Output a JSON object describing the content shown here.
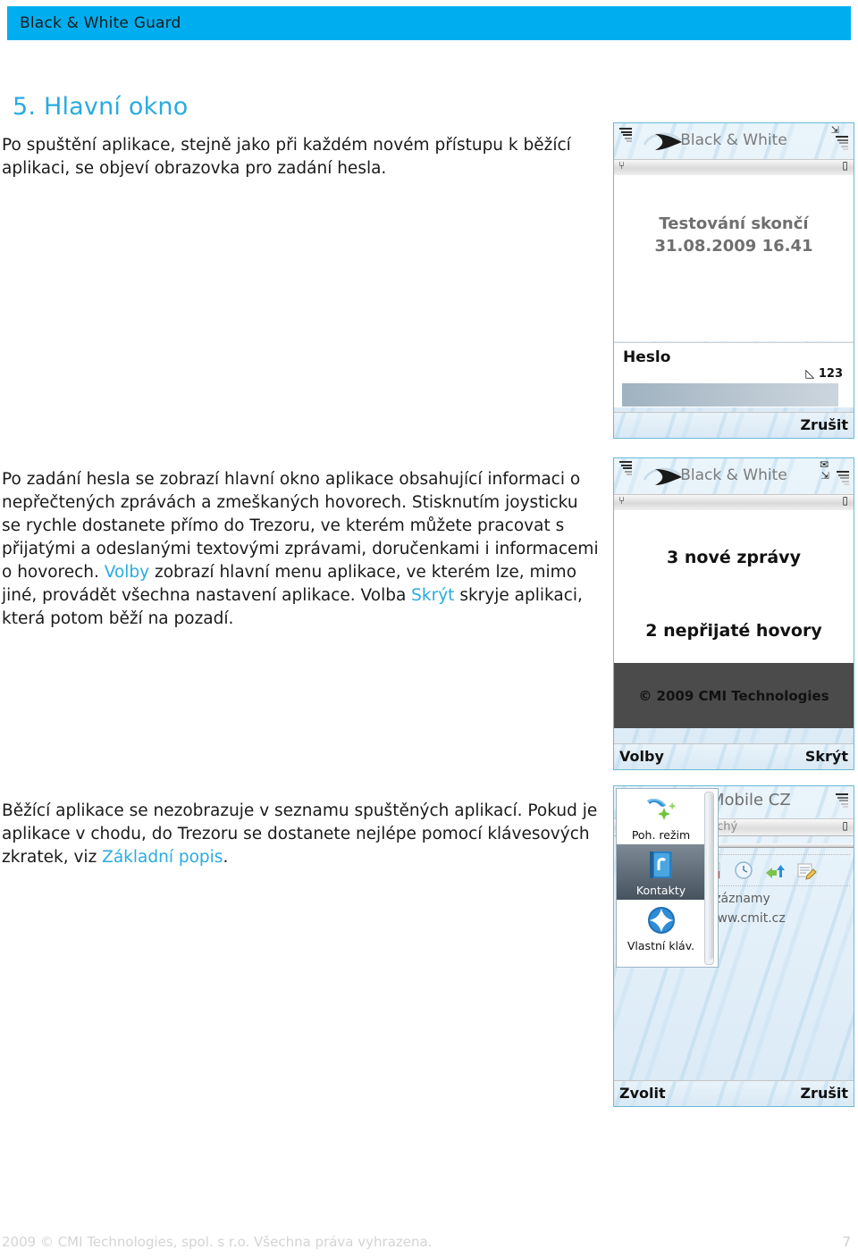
{
  "header": {
    "title": "Black & White Guard",
    "band_color": "#00aeef"
  },
  "document": {
    "heading": "5. Hlavní okno",
    "heading_color": "#29abe2",
    "link_color": "#29abe2",
    "paragraphs": {
      "intro": "Po spuštění aplikace, stejně jako při každém novém přístupu k běžící aplikaci, se objeví obrazovka pro zadání hesla.",
      "main_part1": "Po zadání hesla se zobrazí hlavní okno aplikace obsahující informaci o nepřečtených zprávách a zmeškaných hovorech. Stisknutím joysticku se rychle dostanete přímo do Trezoru, ve kterém můžete pracovat s přijatými a odeslanými textovými zprávami, doručenkami i informacemi o hovorech. ",
      "main_link1": "Volby",
      "main_part2": " zobrazí hlavní menu aplikace, ve kterém lze, mimo jiné, provádět všechna nastavení aplikace. Volba ",
      "main_link2": "Skrýt",
      "main_part3": " skryje aplikaci, která potom běží na pozadí.",
      "tail_part1": "Běžící aplikace se nezobrazuje v seznamu spuštěných aplikací. Pokud je aplikace v chodu, do Trezoru se dostanete nejlépe pomocí klávesových zkratek, viz ",
      "tail_link": "Základní popis",
      "tail_part2": "."
    }
  },
  "phone_password": {
    "app_title": "Black & White",
    "expiry_line1": "Testování skončí",
    "expiry_line2": "31.08.2009 16.41",
    "password_label": "Heslo",
    "input_mode": "123",
    "password_value": "",
    "softkey_right": "Zrušit"
  },
  "phone_main": {
    "app_title": "Black & White",
    "messages_line": "3 nové zprávy",
    "calls_line": "2 nepřijaté hovory",
    "copyright": "© 2009 CMI Technologies",
    "softkey_left": "Volby",
    "softkey_right": "Skrýt"
  },
  "phone_standby": {
    "operator": "Mobile CZ",
    "profile": "Tichý",
    "records": "š. záznamy",
    "url": "www.cmit.cz",
    "menu_items": [
      {
        "label": "Poh. režim",
        "icon": "phone-sparkle-icon",
        "selected": false
      },
      {
        "label": "Kontakty",
        "icon": "contacts-book-icon",
        "selected": true
      },
      {
        "label": "Vlastní kláv.",
        "icon": "custom-keys-icon",
        "selected": false
      }
    ],
    "softkey_left": "Zvolit",
    "softkey_right": "Zrušit"
  },
  "footer": {
    "copyright": "2009 © CMI Technologies, spol. s r.o.  Všechna práva vyhrazena.",
    "page_number": "7"
  }
}
